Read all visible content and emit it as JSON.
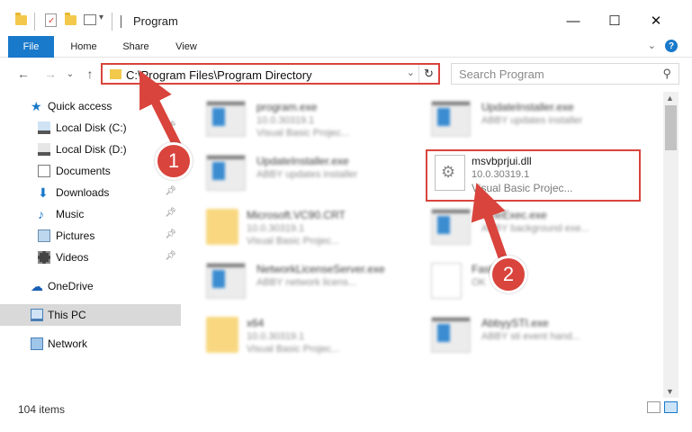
{
  "window": {
    "title": "Program",
    "minimize": "—",
    "maximize": "☐",
    "close": "✕"
  },
  "ribbon": {
    "tabs": [
      "File",
      "Home",
      "Share",
      "View"
    ],
    "expand": "⌄",
    "help": "?"
  },
  "nav": {
    "back": "←",
    "forward": "→",
    "recent": "⌄",
    "up": "↑",
    "address": "C:\\Program Files\\Program Directory",
    "search_placeholder": "Search Program"
  },
  "sidebar": {
    "items": [
      {
        "label": "Quick access",
        "icon": "star-icon",
        "pinned": false
      },
      {
        "label": "Local Disk (C:)",
        "icon": "drive-icon",
        "pinned": true
      },
      {
        "label": "Local Disk (D:)",
        "icon": "drive-icon",
        "pinned": false
      },
      {
        "label": "Documents",
        "icon": "documents-icon",
        "pinned": true
      },
      {
        "label": "Downloads",
        "icon": "download-icon",
        "pinned": true
      },
      {
        "label": "Music",
        "icon": "music-icon",
        "pinned": true
      },
      {
        "label": "Pictures",
        "icon": "pictures-icon",
        "pinned": true
      },
      {
        "label": "Videos",
        "icon": "videos-icon",
        "pinned": true
      },
      {
        "label": "OneDrive",
        "icon": "cloud-icon",
        "pinned": false
      },
      {
        "label": "This PC",
        "icon": "pc-icon",
        "pinned": false,
        "selected": true
      },
      {
        "label": "Network",
        "icon": "network-icon",
        "pinned": false
      }
    ]
  },
  "files": [
    {
      "name": "program.exe",
      "line2": "10.0.30319.1",
      "line3": "Visual Basic Projec...",
      "icon": "app-icon"
    },
    {
      "name": "UpdateInstaller.exe",
      "line2": "ABBY updates installer",
      "line3": "",
      "icon": "app-icon"
    },
    {
      "name": "UpdateInstaller.exe",
      "line2": "ABBY updates installer",
      "line3": "",
      "icon": "app-icon"
    },
    {
      "name": "msvbprjui.dll",
      "line2": "10.0.30319.1",
      "line3": "Visual Basic Projec...",
      "icon": "gear-file-icon"
    },
    {
      "name": "Microsoft.VC90.CRT",
      "line2": "10.0.30319.1",
      "line3": "Visual Basic Projec...",
      "icon": "folder-icon"
    },
    {
      "name": "FineExec.exe",
      "line2": "ABBY background exe...",
      "line3": "",
      "icon": "app-icon"
    },
    {
      "name": "NetworkLicenseServer.exe",
      "line2": "ABBY network licens...",
      "line3": "",
      "icon": "app-icon"
    },
    {
      "name": "FastRegk",
      "line2": "OK",
      "line3": "",
      "icon": "document-icon"
    },
    {
      "name": "x64",
      "line2": "10.0.30319.1",
      "line3": "Visual Basic Projec...",
      "icon": "folder-icon"
    },
    {
      "name": "AbbyySTI.exe",
      "line2": "ABBY sti event hand...",
      "line3": "",
      "icon": "app-icon"
    }
  ],
  "status": {
    "items_count": "104 items"
  },
  "annotations": {
    "step1": "1",
    "step2": "2"
  },
  "colors": {
    "accent": "#1979ca",
    "highlight": "#d9443c",
    "selected": "#d9d9d9"
  }
}
